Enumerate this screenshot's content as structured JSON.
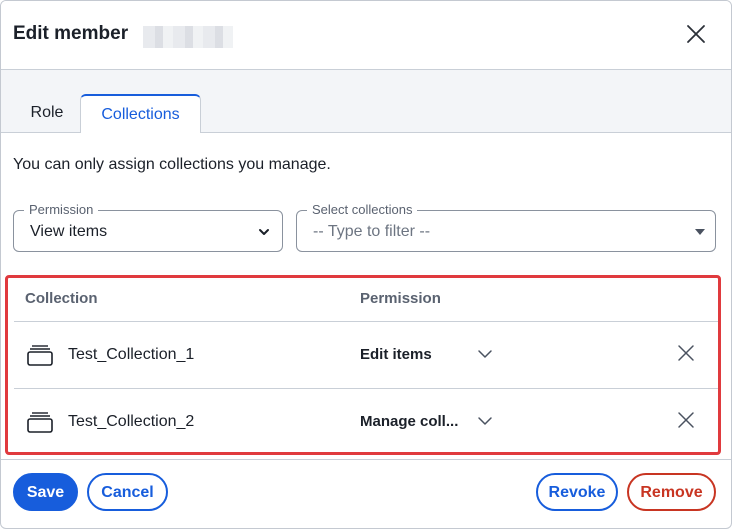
{
  "header": {
    "title": "Edit member",
    "close_icon": "close-icon"
  },
  "tabs": [
    {
      "label": "Role",
      "active": false
    },
    {
      "label": "Collections",
      "active": true
    }
  ],
  "note": "You can only assign collections you manage.",
  "permission_field": {
    "label": "Permission",
    "value": "View items"
  },
  "collections_field": {
    "label": "Select collections",
    "placeholder": "-- Type to filter --"
  },
  "table": {
    "headers": {
      "collection": "Collection",
      "permission": "Permission"
    },
    "rows": [
      {
        "name": "Test_Collection_1",
        "permission": "Edit items",
        "icon": "collection-icon"
      },
      {
        "name": "Test_Collection_2",
        "permission": "Manage coll...",
        "icon": "collection-icon"
      }
    ]
  },
  "footer": {
    "save": "Save",
    "cancel": "Cancel",
    "revoke": "Revoke",
    "remove": "Remove"
  },
  "colors": {
    "primary": "#175ddc",
    "danger": "#c83522",
    "highlight": "#e03a3e"
  }
}
